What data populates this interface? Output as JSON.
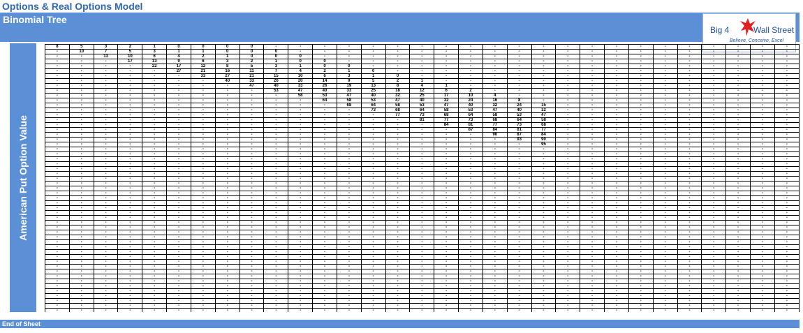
{
  "sheet": {
    "title": "Options & Real Options Model",
    "subtitle": "Binomial Tree",
    "side_label": "American Put Option Value",
    "footer": "End of Sheet"
  },
  "logo": {
    "left_text": "Big 4",
    "right_text": "Wall Street",
    "tagline": "Believe, Conceive, Excel"
  },
  "tree": {
    "columns": 31,
    "rows": 55,
    "empty_marker": "-",
    "cells": [
      [
        8,
        5,
        3,
        2,
        1,
        0,
        0,
        0,
        0,
        "-",
        "-",
        "-",
        "-",
        "-",
        "-",
        "-",
        "-",
        "-",
        "-",
        "-",
        "-",
        "-",
        "-",
        "-",
        "-",
        "-",
        "-",
        "-",
        "-",
        "-",
        "-"
      ],
      [
        "-",
        10,
        7,
        5,
        3,
        1,
        1,
        0,
        0,
        0,
        "-",
        "-",
        "-",
        "-",
        "-",
        "-",
        "-",
        "-",
        "-",
        "-",
        "-",
        "-",
        "-",
        "-",
        "-",
        "-",
        "-",
        "-",
        "-",
        "-",
        "-"
      ],
      [
        "-",
        "-",
        13,
        10,
        6,
        4,
        2,
        1,
        0,
        0,
        0,
        "-",
        "-",
        "-",
        "-",
        "-",
        "-",
        "-",
        "-",
        "-",
        "-",
        "-",
        "-",
        "-",
        "-",
        "-",
        "-",
        "-",
        "-",
        "-",
        "-"
      ],
      [
        "-",
        "-",
        "-",
        17,
        13,
        9,
        6,
        3,
        2,
        1,
        0,
        0,
        "-",
        "-",
        "-",
        "-",
        "-",
        "-",
        "-",
        "-",
        "-",
        "-",
        "-",
        "-",
        "-",
        "-",
        "-",
        "-",
        "-",
        "-",
        "-"
      ],
      [
        "-",
        "-",
        "-",
        "-",
        22,
        17,
        12,
        8,
        5,
        3,
        1,
        0,
        0,
        "-",
        "-",
        "-",
        "-",
        "-",
        "-",
        "-",
        "-",
        "-",
        "-",
        "-",
        "-",
        "-",
        "-",
        "-",
        "-",
        "-",
        "-"
      ],
      [
        "-",
        "-",
        "-",
        "-",
        "-",
        27,
        21,
        16,
        11,
        7,
        4,
        2,
        1,
        0,
        "-",
        "-",
        "-",
        "-",
        "-",
        "-",
        "-",
        "-",
        "-",
        "-",
        "-",
        "-",
        "-",
        "-",
        "-",
        "-",
        "-"
      ],
      [
        "-",
        "-",
        "-",
        "-",
        "-",
        "-",
        33,
        27,
        21,
        15,
        10,
        6,
        3,
        1,
        0,
        "-",
        "-",
        "-",
        "-",
        "-",
        "-",
        "-",
        "-",
        "-",
        "-",
        "-",
        "-",
        "-",
        "-",
        "-",
        "-"
      ],
      [
        "-",
        "-",
        "-",
        "-",
        "-",
        "-",
        "-",
        40,
        33,
        26,
        20,
        14,
        9,
        5,
        2,
        1,
        "-",
        "-",
        "-",
        "-",
        "-",
        "-",
        "-",
        "-",
        "-",
        "-",
        "-",
        "-",
        "-",
        "-",
        "-"
      ],
      [
        "-",
        "-",
        "-",
        "-",
        "-",
        "-",
        "-",
        "-",
        47,
        40,
        33,
        26,
        19,
        13,
        8,
        4,
        1,
        "-",
        "-",
        "-",
        "-",
        "-",
        "-",
        "-",
        "-",
        "-",
        "-",
        "-",
        "-",
        "-",
        "-"
      ],
      [
        "-",
        "-",
        "-",
        "-",
        "-",
        "-",
        "-",
        "-",
        "-",
        53,
        47,
        40,
        33,
        25,
        18,
        12,
        6,
        2,
        "-",
        "-",
        "-",
        "-",
        "-",
        "-",
        "-",
        "-",
        "-",
        "-",
        "-",
        "-",
        "-"
      ],
      [
        "-",
        "-",
        "-",
        "-",
        "-",
        "-",
        "-",
        "-",
        "-",
        "-",
        58,
        53,
        47,
        40,
        32,
        25,
        17,
        10,
        4,
        "-",
        "-",
        "-",
        "-",
        "-",
        "-",
        "-",
        "-",
        "-",
        "-",
        "-",
        "-"
      ],
      [
        "-",
        "-",
        "-",
        "-",
        "-",
        "-",
        "-",
        "-",
        "-",
        "-",
        "-",
        64,
        58,
        53,
        47,
        40,
        32,
        24,
        16,
        8,
        "-",
        "-",
        "-",
        "-",
        "-",
        "-",
        "-",
        "-",
        "-",
        "-",
        "-"
      ],
      [
        "-",
        "-",
        "-",
        "-",
        "-",
        "-",
        "-",
        "-",
        "-",
        "-",
        "-",
        "-",
        68,
        64,
        58,
        53,
        47,
        40,
        32,
        24,
        15,
        "-",
        "-",
        "-",
        "-",
        "-",
        "-",
        "-",
        "-",
        "-",
        "-"
      ],
      [
        "-",
        "-",
        "-",
        "-",
        "-",
        "-",
        "-",
        "-",
        "-",
        "-",
        "-",
        "-",
        "-",
        73,
        68,
        64,
        58,
        53,
        47,
        40,
        32,
        "-",
        "-",
        "-",
        "-",
        "-",
        "-",
        "-",
        "-",
        "-",
        "-"
      ],
      [
        "-",
        "-",
        "-",
        "-",
        "-",
        "-",
        "-",
        "-",
        "-",
        "-",
        "-",
        "-",
        "-",
        "-",
        77,
        73,
        68,
        64,
        58,
        53,
        47,
        "-",
        "-",
        "-",
        "-",
        "-",
        "-",
        "-",
        "-",
        "-",
        "-"
      ],
      [
        "-",
        "-",
        "-",
        "-",
        "-",
        "-",
        "-",
        "-",
        "-",
        "-",
        "-",
        "-",
        "-",
        "-",
        "-",
        81,
        77,
        73,
        68,
        64,
        58,
        "-",
        "-",
        "-",
        "-",
        "-",
        "-",
        "-",
        "-",
        "-",
        "-"
      ],
      [
        "-",
        "-",
        "-",
        "-",
        "-",
        "-",
        "-",
        "-",
        "-",
        "-",
        "-",
        "-",
        "-",
        "-",
        "-",
        "-",
        84,
        81,
        77,
        73,
        68,
        "-",
        "-",
        "-",
        "-",
        "-",
        "-",
        "-",
        "-",
        "-",
        "-"
      ],
      [
        "-",
        "-",
        "-",
        "-",
        "-",
        "-",
        "-",
        "-",
        "-",
        "-",
        "-",
        "-",
        "-",
        "-",
        "-",
        "-",
        "-",
        87,
        84,
        81,
        77,
        "-",
        "-",
        "-",
        "-",
        "-",
        "-",
        "-",
        "-",
        "-",
        "-"
      ],
      [
        "-",
        "-",
        "-",
        "-",
        "-",
        "-",
        "-",
        "-",
        "-",
        "-",
        "-",
        "-",
        "-",
        "-",
        "-",
        "-",
        "-",
        "-",
        90,
        87,
        84,
        "-",
        "-",
        "-",
        "-",
        "-",
        "-",
        "-",
        "-",
        "-",
        "-"
      ],
      [
        "-",
        "-",
        "-",
        "-",
        "-",
        "-",
        "-",
        "-",
        "-",
        "-",
        "-",
        "-",
        "-",
        "-",
        "-",
        "-",
        "-",
        "-",
        "-",
        93,
        90,
        "-",
        "-",
        "-",
        "-",
        "-",
        "-",
        "-",
        "-",
        "-",
        "-"
      ],
      [
        "-",
        "-",
        "-",
        "-",
        "-",
        "-",
        "-",
        "-",
        "-",
        "-",
        "-",
        "-",
        "-",
        "-",
        "-",
        "-",
        "-",
        "-",
        "-",
        "-",
        95,
        "-",
        "-",
        "-",
        "-",
        "-",
        "-",
        "-",
        "-",
        "-",
        "-"
      ]
    ]
  },
  "colors": {
    "accent": "#5b8fd6",
    "title": "#2e67b3",
    "logo_bird": "#e02020"
  }
}
